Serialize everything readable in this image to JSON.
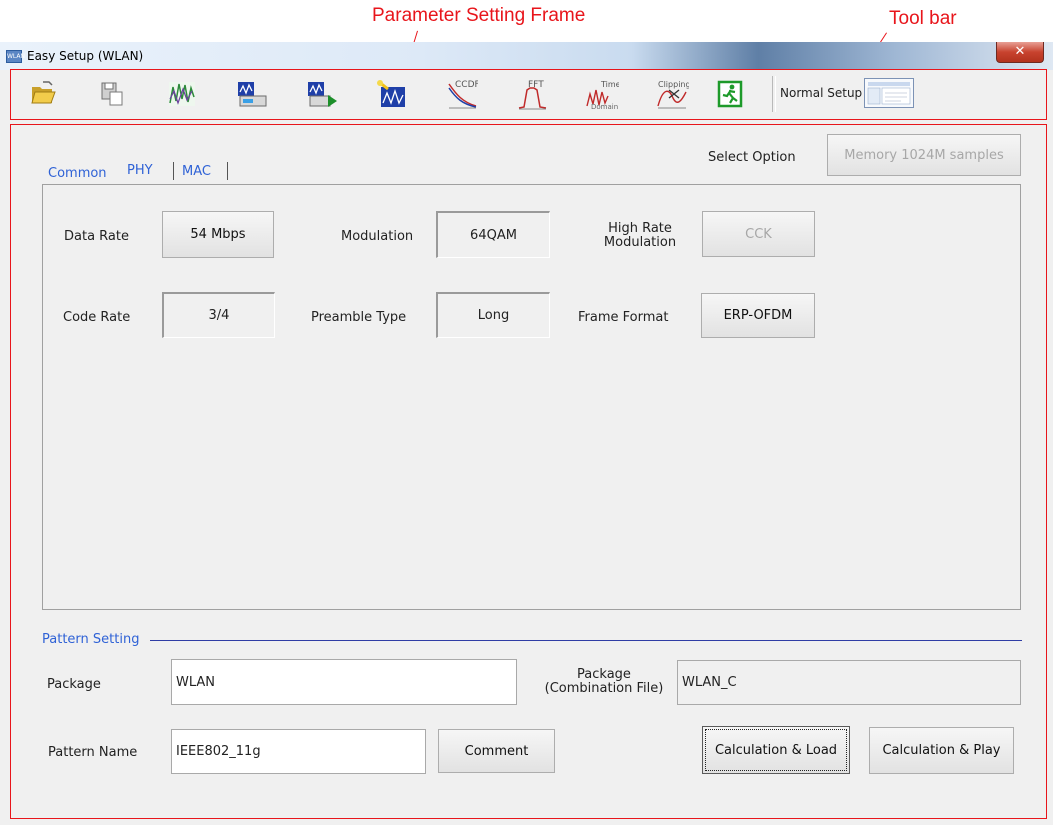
{
  "annotations": {
    "parameter_setting_frame": "Parameter Setting Frame",
    "tool_bar": "Tool bar"
  },
  "window": {
    "title": "Easy Setup (WLAN)",
    "app_icon_text": "WLAN"
  },
  "toolbar": {
    "buttons": [
      {
        "name": "open-icon"
      },
      {
        "name": "save-icon"
      },
      {
        "name": "waveform-icon"
      },
      {
        "name": "load-icon"
      },
      {
        "name": "load-play-icon"
      },
      {
        "name": "calculation-icon"
      },
      {
        "name": "ccdf-icon",
        "text": "CCDF"
      },
      {
        "name": "fft-icon",
        "text": "FFT"
      },
      {
        "name": "time-domain-icon",
        "text": "Time Domain"
      },
      {
        "name": "clipping-icon",
        "text": "Clipping"
      },
      {
        "name": "exit-icon"
      }
    ],
    "normal_setup_label": "Normal Setup"
  },
  "tabs": [
    "Common",
    "PHY",
    "MAC"
  ],
  "select_option": {
    "label": "Select Option",
    "button": "Memory 1024M samples"
  },
  "phy": {
    "data_rate_label": "Data Rate",
    "data_rate_value": "54 Mbps",
    "modulation_label": "Modulation",
    "modulation_value": "64QAM",
    "high_rate_label_1": "High Rate",
    "high_rate_label_2": "Modulation",
    "high_rate_value": "CCK",
    "code_rate_label": "Code Rate",
    "code_rate_value": "3/4",
    "preamble_label": "Preamble Type",
    "preamble_value": "Long",
    "frame_format_label": "Frame Format",
    "frame_format_value": "ERP-OFDM"
  },
  "pattern": {
    "group_title": "Pattern Setting",
    "package_label": "Package",
    "package_value": "WLAN",
    "combo_label_1": "Package",
    "combo_label_2": "(Combination File)",
    "combo_value": "WLAN_C",
    "pattern_name_label": "Pattern Name",
    "pattern_name_value": "IEEE802_11g",
    "comment_button": "Comment",
    "calc_load_button": "Calculation & Load",
    "calc_play_button": "Calculation & Play"
  },
  "colors": {
    "annotation": "#e8151b",
    "tab_text": "#2f62d6"
  }
}
